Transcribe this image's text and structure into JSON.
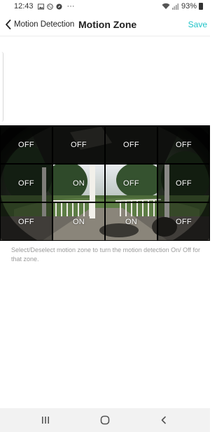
{
  "status_bar": {
    "time": "12:43",
    "battery": "93%",
    "icons": [
      "image-icon",
      "cookie-icon",
      "compass-icon",
      "more-dots-icon",
      "wifi-icon",
      "signal-icon",
      "battery-icon"
    ]
  },
  "header": {
    "back_label": "Motion Detection",
    "title": "Motion Zone",
    "save_label": "Save"
  },
  "zones": [
    {
      "label": "OFF",
      "state": "off"
    },
    {
      "label": "OFF",
      "state": "off"
    },
    {
      "label": "OFF",
      "state": "off"
    },
    {
      "label": "OFF",
      "state": "off"
    },
    {
      "label": "OFF",
      "state": "off"
    },
    {
      "label": "ON",
      "state": "on"
    },
    {
      "label": "OFF",
      "state": "on"
    },
    {
      "label": "OFF",
      "state": "off"
    },
    {
      "label": "OFF",
      "state": "off"
    },
    {
      "label": "ON",
      "state": "on"
    },
    {
      "label": "ON",
      "state": "on"
    },
    {
      "label": "OFF",
      "state": "off"
    }
  ],
  "hint_text": "Select/Deselect motion zone to turn the motion detection On/ Off for that zone.",
  "nav_bar": {
    "buttons": [
      "recent-apps-icon",
      "home-icon",
      "back-icon"
    ]
  },
  "colors": {
    "accent": "#1fc3c8",
    "hint_text": "#9a9a9a",
    "nav_bg": "#f2f2f2"
  }
}
